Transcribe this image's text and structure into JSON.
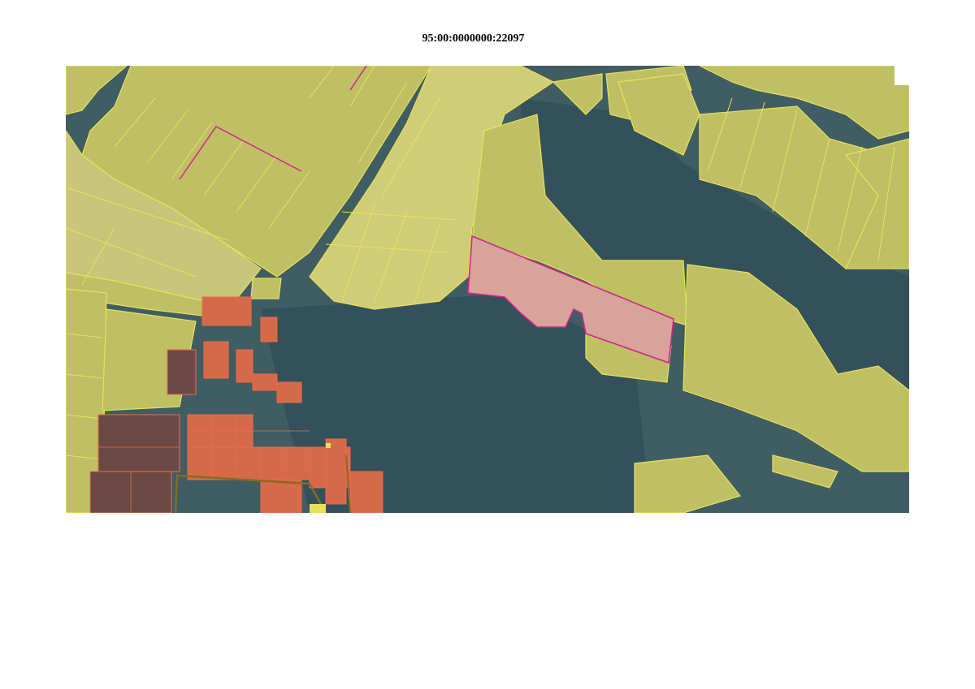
{
  "document": {
    "cadastral_number": "95:00:0000000:22097"
  },
  "map": {
    "colors": {
      "background_dark": "#3c5a63",
      "forest": "#2f4a50",
      "field_fill": "#c9c86a",
      "field_border": "#e8e25a",
      "settlement_parcel": "#e0603f",
      "settlement_dark_parcel": "#6e4a44",
      "selected_parcel_fill": "#d8a39b",
      "selected_parcel_border": "#d0268a",
      "road_border": "#8a6a20"
    },
    "layers": [
      "imagery",
      "agricultural-parcels",
      "settlement-parcels",
      "selected-parcel"
    ]
  }
}
